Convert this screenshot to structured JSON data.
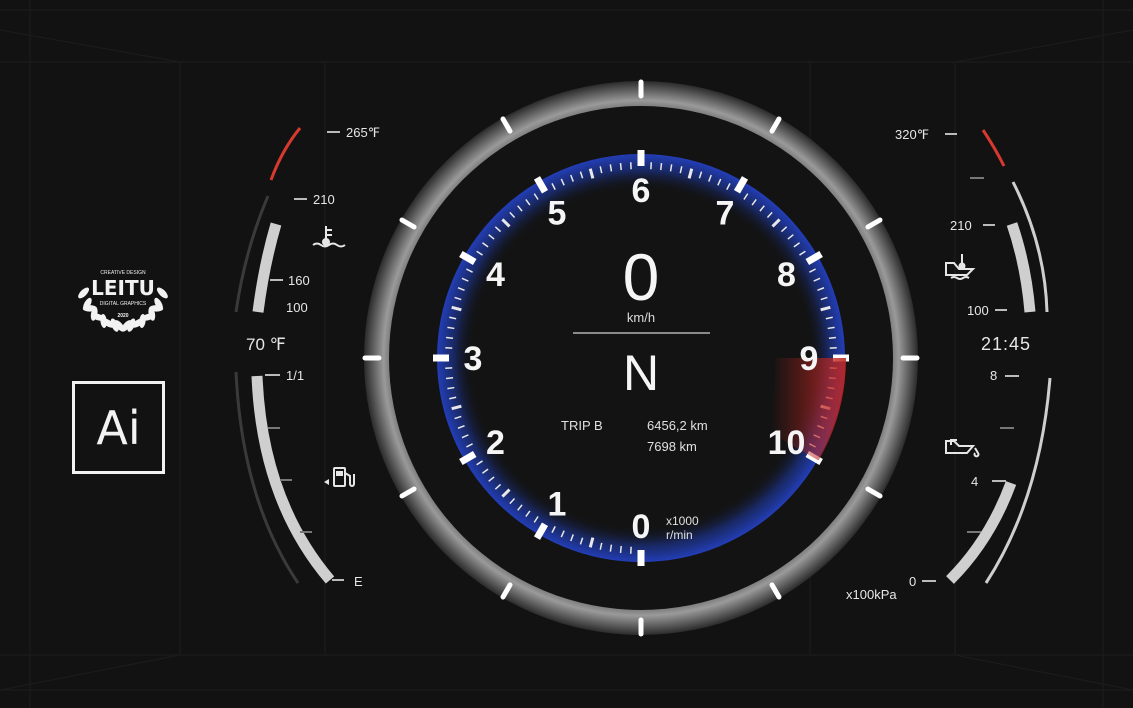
{
  "colors": {
    "background": "#121212",
    "tach_arc_blue": "#1f3aa8",
    "redline": "#c0261f",
    "gauge_fill": "#cfcfcf",
    "needle_warning": "#e0392d"
  },
  "logo": {
    "top_text": "CREATIVE DESIGN",
    "name": "LEITU",
    "sub_text": "DIGITAL GRAPHICS",
    "year": "2020",
    "icon": "laurel-wreath-icon"
  },
  "ai_badge": {
    "label": "Ai"
  },
  "left_gauges": {
    "temp": {
      "max_label": "265℉",
      "mark_210": "210",
      "mark_160": "160",
      "mark_100": "100",
      "current": "70 ℉",
      "icon": "coolant-temp-icon",
      "fill_fraction": 0.45
    },
    "fuel": {
      "full_label": "1/1",
      "empty_label": "E",
      "icon": "fuel-pump-icon",
      "fill_fraction": 0.85
    }
  },
  "right_gauges": {
    "oil_temp": {
      "max_label": "320℉",
      "mark_210": "210",
      "mark_100": "100",
      "icon": "oil-temp-icon",
      "fill_fraction": 0.45
    },
    "clock": "21:45",
    "oil_pressure": {
      "mark_8": "8",
      "mark_4": "4",
      "mark_0": "0",
      "unit": "x100kPa",
      "icon": "oil-pressure-icon",
      "fill_fraction": 0.5
    }
  },
  "tachometer": {
    "speed_value": "0",
    "speed_unit": "km/h",
    "gear": "N",
    "trip_label": "TRIP B",
    "trip_distance": "6456,2 km",
    "odometer": "7698 km",
    "rpm_unit_line1": "x1000",
    "rpm_unit_line2": "r/min",
    "rpm_labels": [
      "0",
      "1",
      "2",
      "3",
      "4",
      "5",
      "6",
      "7",
      "8",
      "9",
      "10"
    ],
    "redline_from": 9,
    "max_rpm": 10
  }
}
